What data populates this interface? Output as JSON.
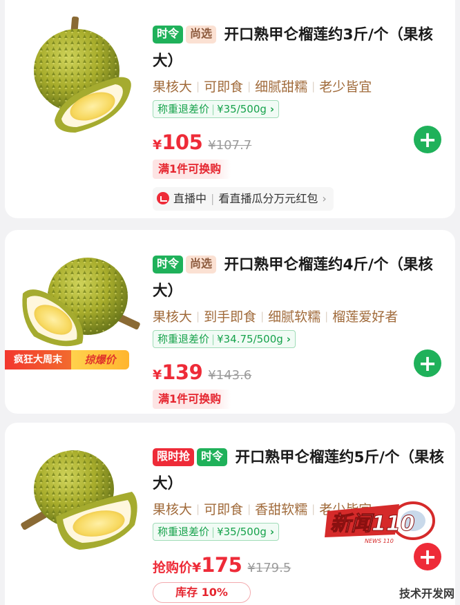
{
  "products": [
    {
      "tags": [
        "时令",
        "尚选"
      ],
      "title": "开口熟甲仑榴莲约3斤/个（果核大）",
      "features": [
        "果核大",
        "可即食",
        "细腻甜糯",
        "老少皆宜"
      ],
      "refund": {
        "label": "称重退差价",
        "price": "¥35/500g",
        "chevron": "›"
      },
      "price_prefix": "",
      "currency": "¥",
      "price": "105",
      "original_price": "¥107.7",
      "promo": "满1件可换购",
      "live": {
        "status": "直播中",
        "text": "看直播瓜分万元红包",
        "chevron": "›"
      },
      "add_icon": "plus-icon"
    },
    {
      "tags": [
        "时令",
        "尚选"
      ],
      "title": "开口熟甲仑榴莲约4斤/个（果核大）",
      "features": [
        "果核大",
        "到手即食",
        "细腻软糯",
        "榴莲爱好者"
      ],
      "refund": {
        "label": "称重退差价",
        "price": "¥34.75/500g",
        "chevron": "›"
      },
      "price_prefix": "",
      "currency": "¥",
      "price": "139",
      "original_price": "¥143.6",
      "promo": "满1件可换购",
      "badges": [
        "疯狂大周末",
        "掠爆价"
      ],
      "add_icon": "plus-icon"
    },
    {
      "tags": [
        "限时抢",
        "时令"
      ],
      "title": "开口熟甲仑榴莲约5斤/个（果核大）",
      "features": [
        "果核大",
        "可即食",
        "香甜软糯",
        "老少皆宜"
      ],
      "refund": {
        "label": "称重退差价",
        "price": "¥35/500g",
        "chevron": "›"
      },
      "price_prefix": "抢购价",
      "currency": "¥",
      "price": "175",
      "original_price": "¥179.5",
      "stock": "库存 10%",
      "add_icon": "plus-icon"
    }
  ],
  "watermarks": {
    "news_logo": "新闻110",
    "news_sub": "NEWS 110",
    "site": "技术开发网"
  },
  "colors": {
    "accent_green": "#1fb15a",
    "accent_red": "#ee2b38",
    "feature_brown": "#a06a3a"
  }
}
